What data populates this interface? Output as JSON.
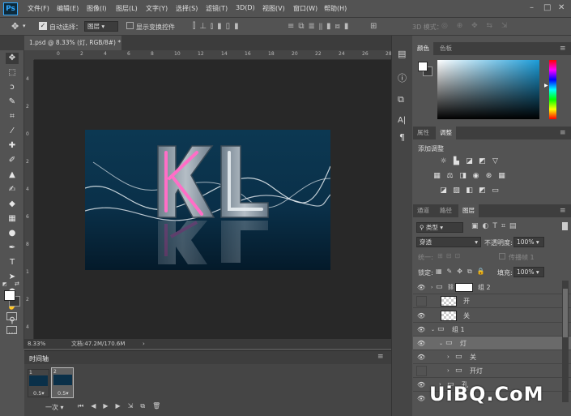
{
  "app": {
    "logo": "Ps"
  },
  "menu": [
    "文件(F)",
    "编辑(E)",
    "图像(I)",
    "图层(L)",
    "文字(Y)",
    "选择(S)",
    "滤镜(T)",
    "3D(D)",
    "视图(V)",
    "窗口(W)",
    "帮助(H)"
  ],
  "options": {
    "auto_select_label": "自动选择：",
    "auto_select_value": "图层",
    "show_transform_label": "显示变换控件",
    "mode_3d": "3D 模式："
  },
  "document": {
    "tab_title": "1.psd @ 8.33% (灯, RGB/8#) *",
    "zoom": "8.33%",
    "doc_info": "文档:47.2M/170.6M",
    "canvas_text": "KL"
  },
  "rulers": {
    "h": [
      "0",
      "2",
      "4",
      "6",
      "8",
      "10",
      "12",
      "14",
      "16",
      "18",
      "20",
      "22",
      "24",
      "26",
      "28"
    ],
    "v": [
      "4",
      "2",
      "0",
      "2",
      "4",
      "6",
      "8",
      "1",
      "2",
      "4"
    ]
  },
  "timeline": {
    "title": "时间轴",
    "frames": [
      {
        "num": "1",
        "delay": "0.5"
      },
      {
        "num": "2",
        "delay": "0.5"
      }
    ],
    "loop": "一次"
  },
  "color_panel": {
    "tabs": [
      "颜色",
      "色板"
    ]
  },
  "adjust_panel": {
    "tabs": [
      "属性",
      "调整"
    ],
    "title": "添加调整"
  },
  "layers_panel": {
    "tabs": [
      "通道",
      "路径",
      "图层"
    ],
    "filter_kind": "类型",
    "blend_mode": "穿透",
    "opacity_label": "不透明度:",
    "opacity_value": "100%",
    "unify_label": "统一:",
    "propagate_label": "传播帧 1",
    "lock_label": "锁定:",
    "fill_label": "填充:",
    "fill_value": "100%",
    "layers": [
      {
        "name": "组 2",
        "visible": true
      },
      {
        "name": "开",
        "visible": false
      },
      {
        "name": "关",
        "visible": true
      },
      {
        "name": "组 1",
        "visible": true
      },
      {
        "name": "灯",
        "visible": true
      },
      {
        "name": "关",
        "visible": true
      },
      {
        "name": "开灯",
        "visible": false
      },
      {
        "name": "孔",
        "visible": true
      }
    ]
  },
  "watermark": "UiBQ.CoM",
  "colors": {
    "canvas_top": "#0c3852",
    "canvas_bottom": "#041a2a",
    "neon": "#ff6ec7",
    "accent": "#31a8ff"
  }
}
